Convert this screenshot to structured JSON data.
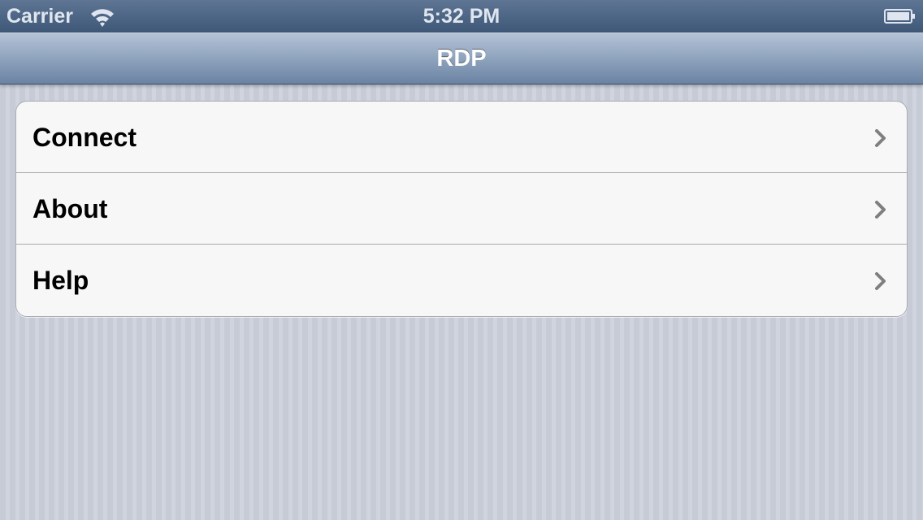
{
  "status_bar": {
    "carrier": "Carrier",
    "time": "5:32 PM",
    "wifi_icon": "wifi-icon",
    "battery_icon": "battery-icon"
  },
  "nav_bar": {
    "title": "RDP"
  },
  "menu": {
    "items": [
      {
        "label": "Connect",
        "icon": "chevron-right-icon"
      },
      {
        "label": "About",
        "icon": "chevron-right-icon"
      },
      {
        "label": "Help",
        "icon": "chevron-right-icon"
      }
    ]
  },
  "colors": {
    "status_bar": "#4a6382",
    "nav_bar": "#8ea3bd",
    "cell_background": "#f7f7f7",
    "chevron": "#7f7f7f"
  }
}
